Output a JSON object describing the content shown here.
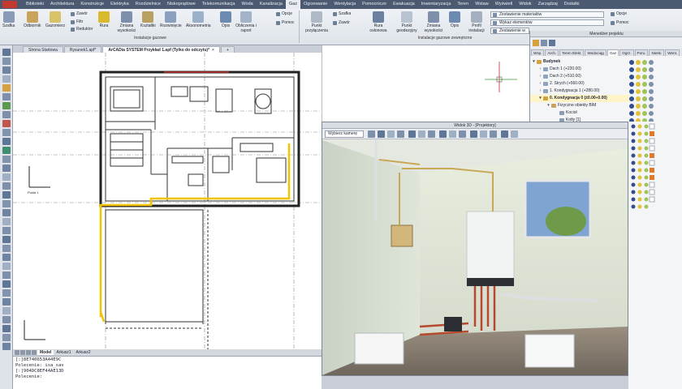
{
  "menu": {
    "tabs": [
      "Biblioteki",
      "Architektura",
      "Konstrukcje",
      "Elektryka",
      "Rozdzielnice",
      "Niskoprądowe",
      "Telekomunikacja",
      "Woda",
      "Kanalizacja",
      "Gaz",
      "Ogrzewanie",
      "Wentylacja",
      "Pomocnicze",
      "Ewakuacja",
      "Inwentaryzacja",
      "Teren",
      "Wstaw",
      "Wyświetl",
      "Zarządzaj",
      "Widok",
      "Zarządzaj",
      "Dodatki"
    ],
    "tabs_display": [
      "Biblioteki",
      "Architektura",
      "Konstrukcje",
      "Elektryka",
      "Rozdzielnice",
      "Niskoprądowe",
      "Telekomunikacja",
      "Woda",
      "Kanalizacja",
      "Gaz",
      "Ogrzewanie",
      "Wentylacja",
      "Pomocnicze",
      "Ewakuacja",
      "Inwentaryzacja",
      "Teren",
      "Wstaw",
      "Wyświetl",
      "Widok",
      "Zarządzaj",
      "Dodatki"
    ],
    "active": "Gaz"
  },
  "ribbon": {
    "szafka": "Szafka",
    "odbiornik": "Odbiornik",
    "gazomierz": "Gazomierz",
    "zawor": "Zawór",
    "filtr": "Filtr",
    "reduktor": "Reduktor",
    "rura": "Rura",
    "zmiana_wysokosci": "Zmiana wysokości",
    "ksztaltki": "Kształtki",
    "rozwiniecie": "Rozwinięcie",
    "aksonometria": "Aksonometria",
    "opis": "Opis",
    "obliczenia": "Obliczenia i raport",
    "opcje": "Opcje",
    "pomoc": "Pomoc",
    "group1": "Instalacje gazowe",
    "punkt_przylaczenia": "Punkt przyłączenia",
    "szafka2": "Szafka",
    "zawor2": "Zawór",
    "rura_oslonowa": "Rura osłonowa",
    "punkt_geodezyjny": "Punkt geodezyjny",
    "zmiana_wysokosci2": "Zmiana wysokości",
    "opis2": "Opis",
    "profil_instalacji": "Profil instalacji",
    "zestawienie_materialow": "Zestawienie materiałów",
    "wykaz_elementow": "Wykaz elementów",
    "zestawienie_w": "Zestawienie w",
    "opcje2": "Opcje",
    "pomoc2": "Pomoc",
    "group2": "Instalacje gazowe zewnętrzne"
  },
  "doc_tabs": {
    "tab1": "Strona Startowa",
    "tab2": "Rysunek1.apf*",
    "tab3": "ArCADia SYSTEM Przykład 1.apf (Tylko do odczytu)*",
    "add": "+"
  },
  "drawing": {
    "axis_label": "Punkt 1"
  },
  "cad_tabs": [
    "Model",
    "Arkusz1",
    "Arkusz2"
  ],
  "project_manager": {
    "title": "Menedżer projektu",
    "tabs": [
      "Wsp.",
      "Arch.",
      "Teren Elekt.",
      "Wodociąg",
      "Gaz",
      "Ogrz.",
      "Poru.",
      "Niesk.",
      "Went."
    ],
    "active_tab": "Gaz",
    "tree": [
      {
        "label": "Budynek",
        "level": 0,
        "bold": true,
        "expanded": true
      },
      {
        "label": "Dach 1 (+220.00)",
        "level": 1
      },
      {
        "label": "Dach 2 (+510.00)",
        "level": 1
      },
      {
        "label": "2. Strych (+560.00)",
        "level": 1
      },
      {
        "label": "1. Kondygnacja 1 (+280.00)",
        "level": 1
      },
      {
        "label": "0. Kondygnacja 0 (±0.00÷0.00)",
        "level": 1,
        "bold": true,
        "expanded": true
      },
      {
        "label": "Fizyczne obiekty BIM",
        "level": 2,
        "expanded": true
      },
      {
        "label": "Kocioł",
        "level": 3
      },
      {
        "label": "Kotły [1]",
        "level": 3
      }
    ]
  },
  "view3d": {
    "title": "Widok 3D - [Projektory]",
    "camera_select": "Wybierz kamerę"
  },
  "command_line": [
    "[:]8E740653A44E9C",
    "Polecenie: isa_sav",
    "[:]904DC8EF44AE13D",
    "Polecenie:"
  ],
  "colors": {
    "menubar": "#4b5a70",
    "pipe_yellow": "#f2c400",
    "pipe_red": "#c0302a",
    "accent_orange": "#e0782f"
  }
}
